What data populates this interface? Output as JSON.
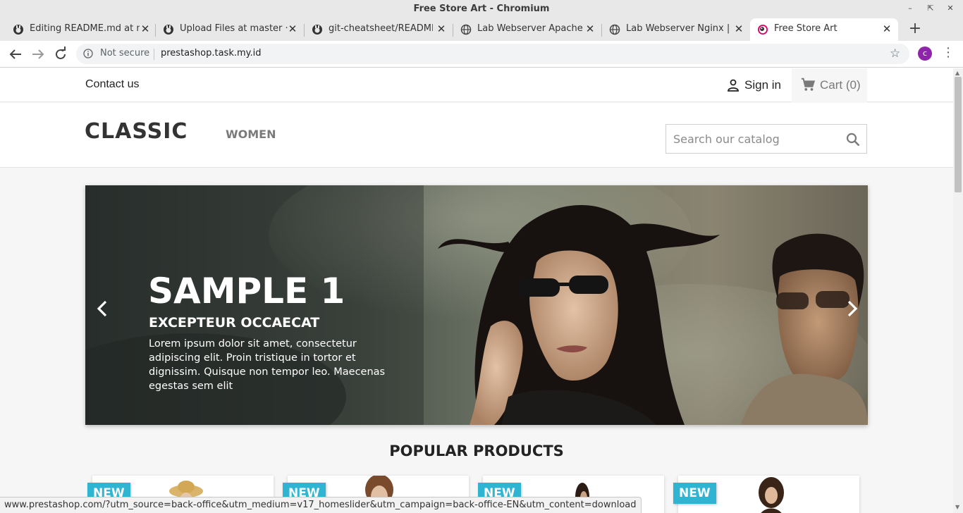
{
  "window": {
    "title": "Free Store Art - Chromium"
  },
  "tabs": [
    {
      "label": "Editing README.md at m",
      "icon": "github-icon"
    },
    {
      "label": "Upload Files at master · y",
      "icon": "github-icon"
    },
    {
      "label": "git-cheatsheet/README.",
      "icon": "github-icon"
    },
    {
      "label": "Lab Webserver Apache | N",
      "icon": "globe-icon"
    },
    {
      "label": "Lab Webserver Nginx | Ne",
      "icon": "globe-icon"
    },
    {
      "label": "Free Store Art",
      "icon": "prestashop-icon",
      "active": true
    }
  ],
  "toolbar": {
    "security_label": "Not secure",
    "url": "prestashop.task.my.id",
    "profile_initial": "c"
  },
  "header": {
    "contact": "Contact us",
    "sign_in": "Sign in",
    "cart": "Cart (0)",
    "logo": "CLASSIC",
    "menu": [
      "WOMEN"
    ],
    "search_placeholder": "Search our catalog"
  },
  "slider": {
    "title": "SAMPLE 1",
    "subtitle": "EXCEPTEUR OCCAECAT",
    "text": "Lorem ipsum dolor sit amet, consectetur adipiscing elit. Proin tristique in tortor et dignissim. Quisque non tempor leo. Maecenas egestas sem elit"
  },
  "popular": {
    "title": "POPULAR PRODUCTS",
    "badges": [
      "NEW",
      "NEW",
      "NEW",
      "NEW"
    ]
  },
  "status_url": "www.prestashop.com/?utm_source=back-office&utm_medium=v17_homeslider&utm_campaign=back-office-EN&utm_content=download",
  "colors": {
    "accent": "#2fb5d2",
    "profile": "#8e24aa"
  }
}
